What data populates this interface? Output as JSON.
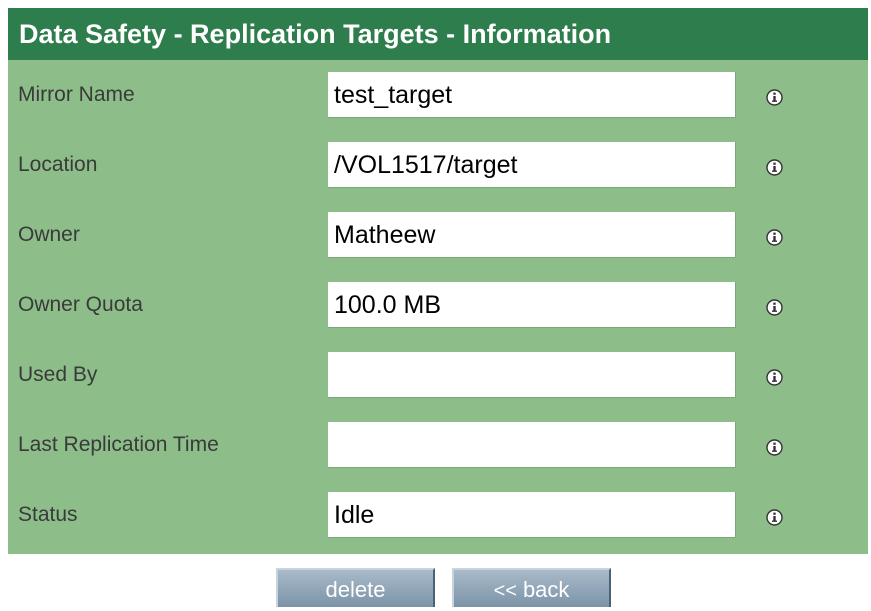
{
  "header": {
    "title": "Data Safety - Replication Targets - Information"
  },
  "fields": [
    {
      "label": "Mirror Name",
      "value": "test_target"
    },
    {
      "label": "Location",
      "value": "/VOL1517/target"
    },
    {
      "label": "Owner",
      "value": "Matheew"
    },
    {
      "label": "Owner Quota",
      "value": "100.0 MB"
    },
    {
      "label": "Used By",
      "value": ""
    },
    {
      "label": "Last Replication Time",
      "value": ""
    },
    {
      "label": "Status",
      "value": "Idle"
    }
  ],
  "icons": {
    "field_help": "info-icon",
    "back": "back-arrow-icon"
  },
  "buttons": {
    "delete_label": "delete",
    "back_glyph": "<<",
    "back_label": "back"
  },
  "colors": {
    "header_bg": "#2e7d4c",
    "panel_bg": "#8dbe8a",
    "button_bg": "#8fa3b7"
  }
}
